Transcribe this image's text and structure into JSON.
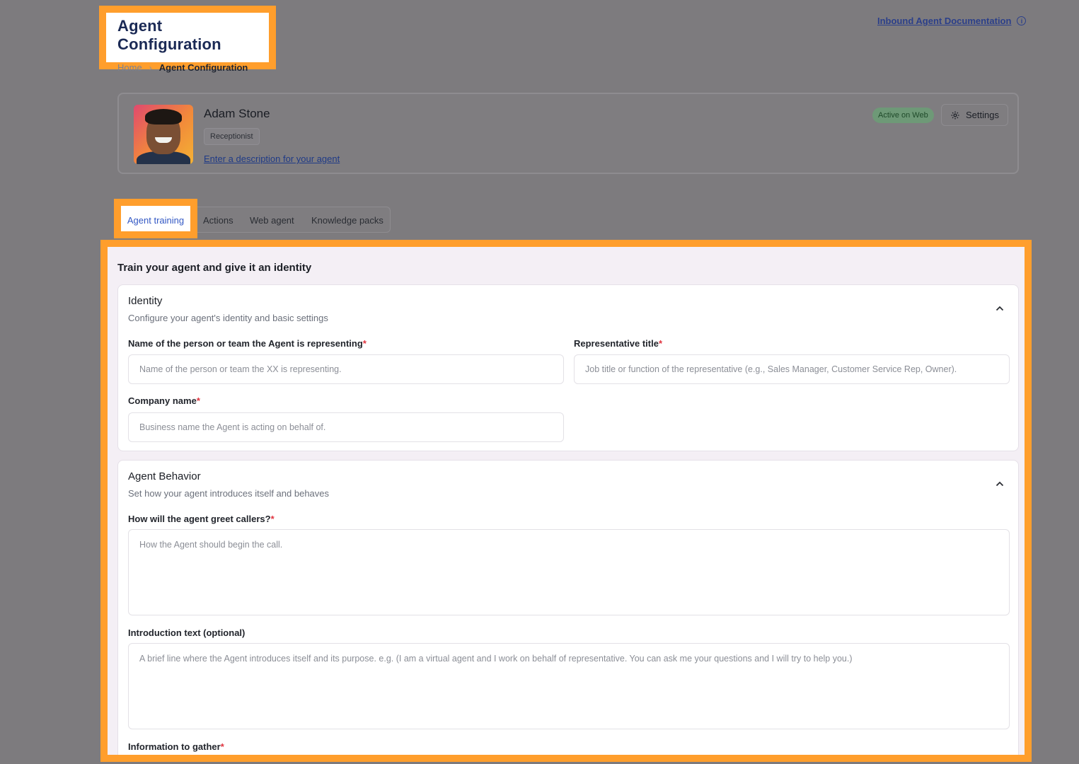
{
  "header": {
    "title": "Agent Configuration",
    "breadcrumb": {
      "home": "Home",
      "separator": "›",
      "current": "Agent Configuration"
    },
    "doc_link": "Inbound Agent Documentation",
    "doc_info_glyph": "i"
  },
  "agent": {
    "name": "Adam Stone",
    "role": "Receptionist",
    "description_link": "Enter a description for your agent",
    "status": "Active on Web",
    "settings_label": "Settings"
  },
  "tabs": [
    {
      "label": "Agent training",
      "active": true
    },
    {
      "label": "Actions",
      "active": false
    },
    {
      "label": "Web agent",
      "active": false
    },
    {
      "label": "Knowledge packs",
      "active": false
    }
  ],
  "main": {
    "heading": "Train your agent and give it an identity",
    "identity": {
      "title": "Identity",
      "subtitle": "Configure your agent's identity and basic settings",
      "name_label": "Name of the person or team the Agent is representing",
      "name_placeholder": "Name of the person or team the XX is representing.",
      "title_label": "Representative title",
      "title_placeholder": "Job title or function of the representative (e.g., Sales Manager, Customer Service Rep, Owner).",
      "company_label": "Company name",
      "company_placeholder": "Business name the Agent is acting on behalf of."
    },
    "behavior": {
      "title": "Agent Behavior",
      "subtitle": "Set how your agent introduces itself and behaves",
      "greet_label": "How will the agent greet callers?",
      "greet_placeholder": "How the Agent should begin the call.",
      "intro_label": "Introduction text (optional)",
      "intro_placeholder": "A brief line where the Agent introduces itself and its purpose. e.g. (I am a virtual agent and I work on behalf of representative. You can ask me your questions and I will try to help you.)",
      "info_label": "Information to gather"
    },
    "required_marker": "*"
  },
  "colors": {
    "highlight": "#ff9e2c",
    "link": "#2b3f8a",
    "active_tab": "#3358c4",
    "required": "#e0343f"
  },
  "icons": [
    "info-icon",
    "gear-icon",
    "chevron-up-icon",
    "chevron-right-icon"
  ]
}
